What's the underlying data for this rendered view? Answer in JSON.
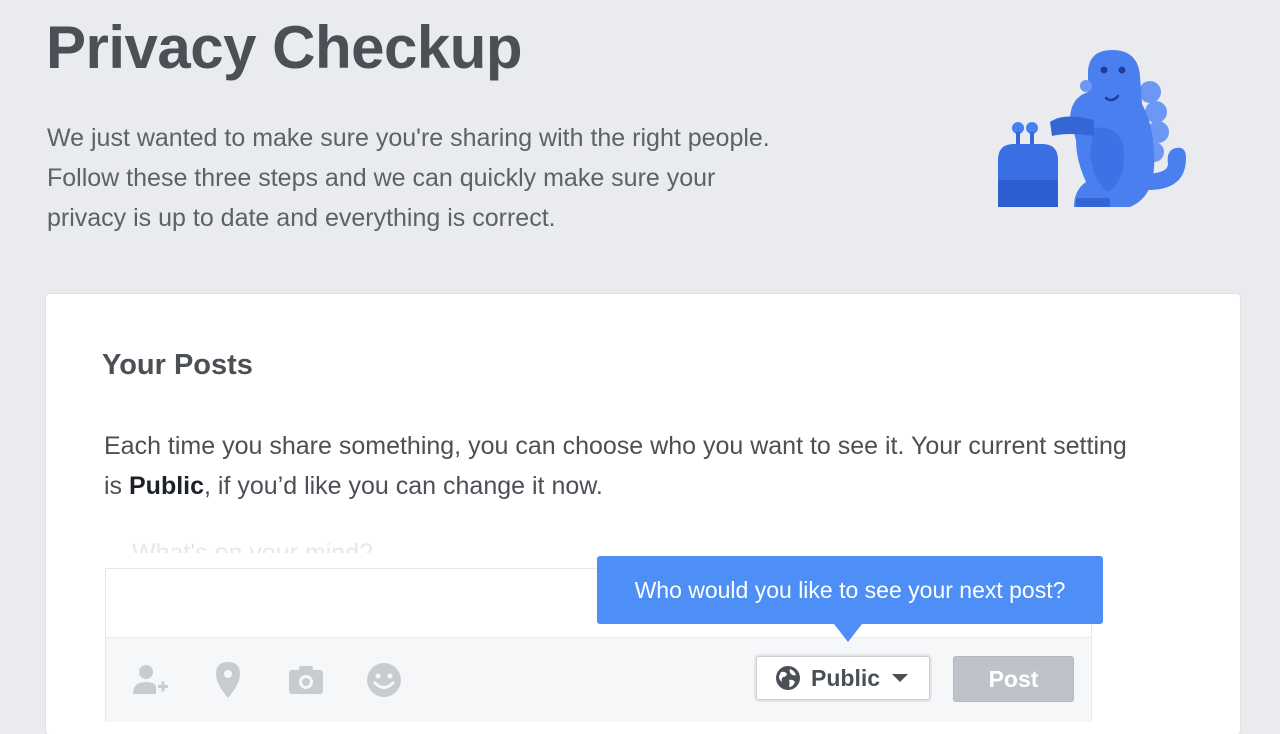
{
  "page": {
    "title": "Privacy Checkup",
    "intro": [
      "We just wanted to make sure you're sharing with the right people.",
      "Follow these three steps and we can quickly make sure your",
      "privacy is up to date and everything is correct."
    ],
    "mascot_icon": "blue-dinosaur-mascot"
  },
  "card": {
    "title": "Your Posts",
    "desc_before": "Each time you share something, you can choose who you want to see it. Your current setting is ",
    "desc_bold": "Public",
    "desc_after": ", if you’d like you can change it now."
  },
  "composer": {
    "placeholder": "What's on your mind?",
    "tools": [
      "tag-friends-icon",
      "location-icon",
      "camera-icon",
      "emoji-icon"
    ],
    "privacy_label": "Public",
    "privacy_icon": "globe-icon",
    "post_label": "Post"
  },
  "tooltip": {
    "text": "Who would you like to see your next post?"
  },
  "colors": {
    "background": "#e9ebee",
    "accent": "#4e8ef7",
    "mascot": "#4a7ff0",
    "post_disabled": "#bec3c9"
  }
}
